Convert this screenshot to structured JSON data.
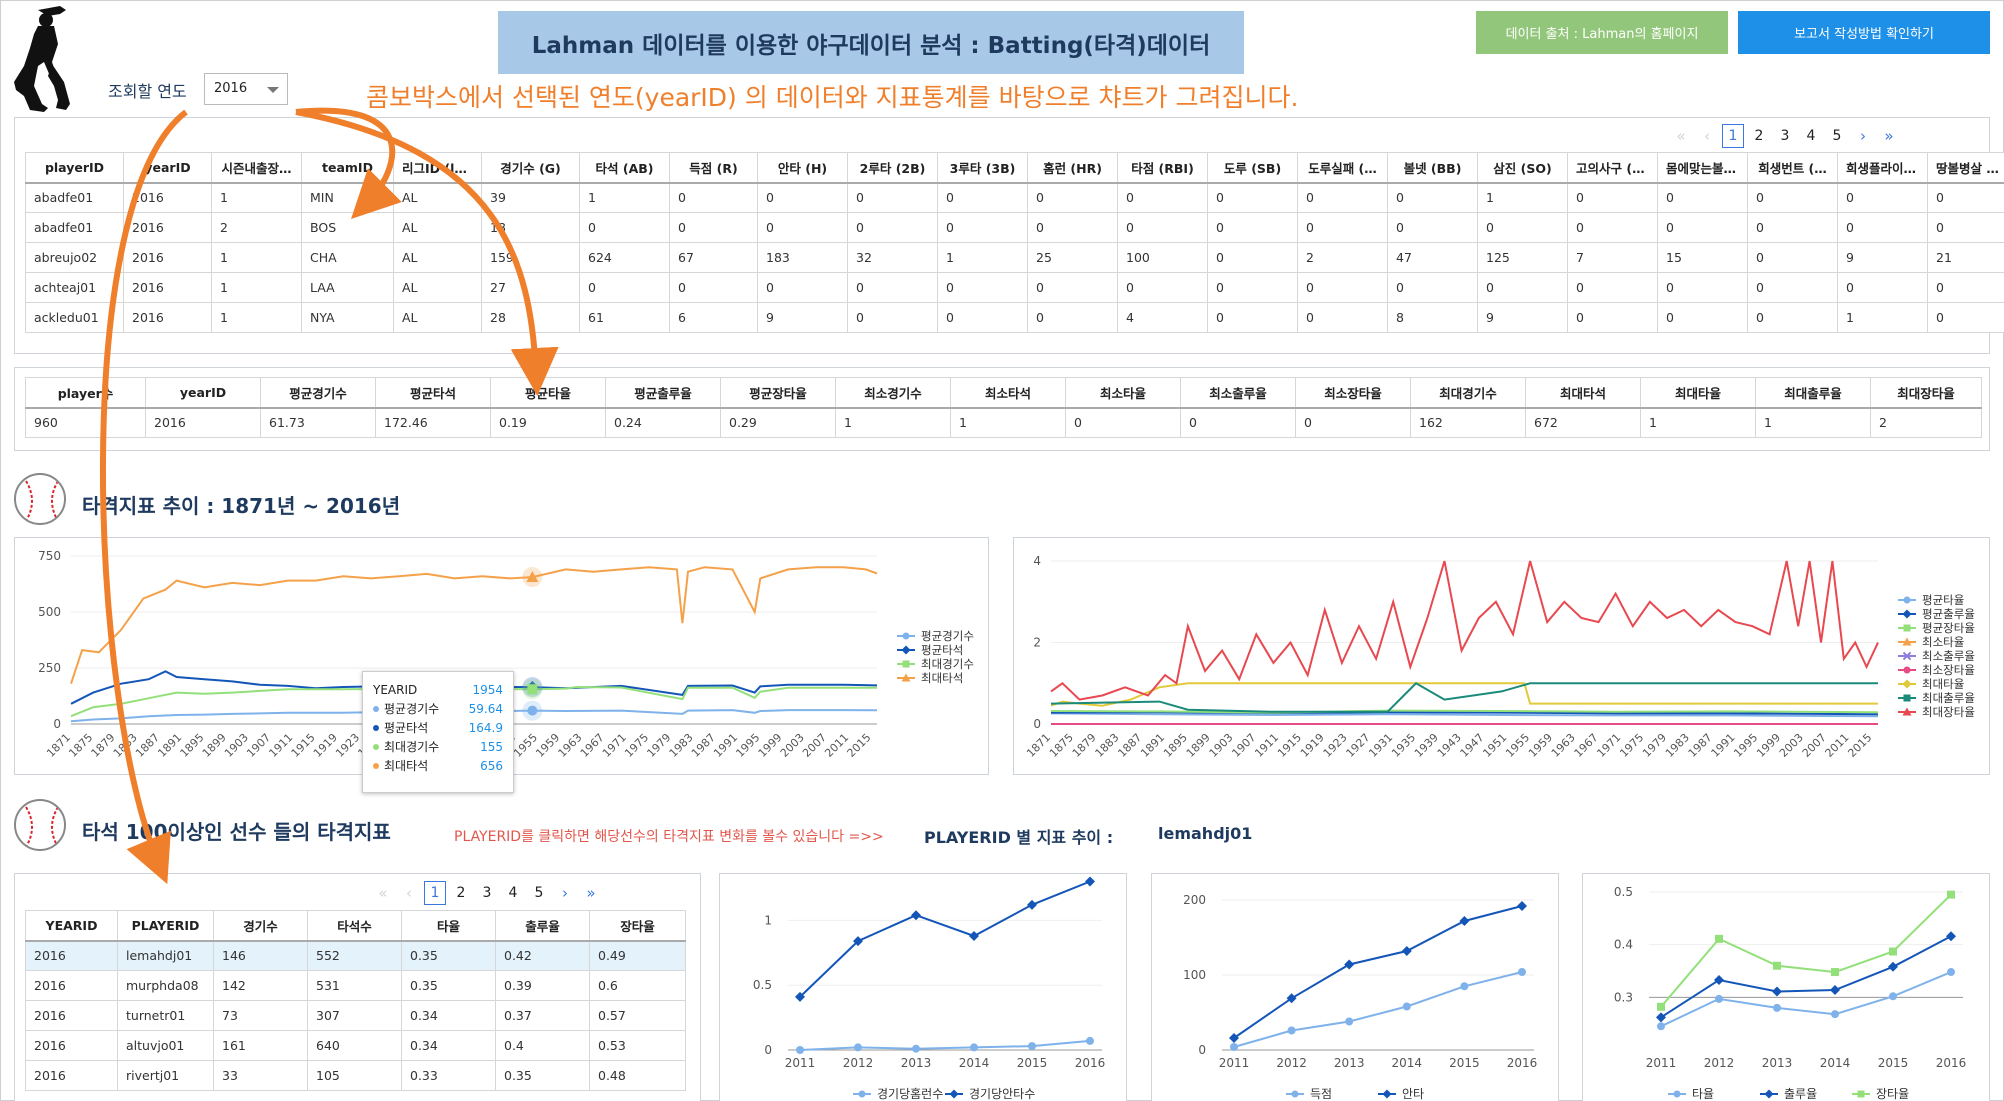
{
  "header": {
    "title": "Lahman 데이터를 이용한 야구데이터 분석 : Batting(타격)데이터",
    "source_button": "데이터 출처 : Lahman의 홈페이지",
    "guide_button": "보고서 작성방법 확인하기",
    "year_label": "조회할 연도",
    "year_value": "2016",
    "info_text": "콤보박스에서 선택된 연도(yearID) 의 데이터와 지표통계를 바탕으로 챠트가 그려집니다."
  },
  "colors": {
    "title_bg": "#a7c8e6",
    "green_button": "#92c77b",
    "blue_button": "#1e90e8",
    "annotation": "#f07f2c",
    "accent_red": "#e2574c"
  },
  "icons": {
    "player_logo": "batter-silhouette-icon",
    "section_icon": "baseball-icon"
  },
  "batting_table": {
    "pager": {
      "first": "«",
      "prev": "‹",
      "pages": [
        "1",
        "2",
        "3",
        "4",
        "5"
      ],
      "current": "1",
      "next": "›",
      "last": "»"
    },
    "columns": [
      "playerID",
      "yearID",
      "시즌내출장…",
      "teamID",
      "리그ID (lgID)",
      "경기수 (G)",
      "타석 (AB)",
      "득점 (R)",
      "안타 (H)",
      "2루타 (2B)",
      "3루타 (3B)",
      "홈런 (HR)",
      "타점 (RBI)",
      "도루 (SB)",
      "도루실패 (…",
      "볼넷 (BB)",
      "삼진 (SO)",
      "고의사구 (I…",
      "몸에맞는볼 …",
      "희생번트 (…",
      "희생플라이 …",
      "땅볼병살 (…"
    ],
    "rows": [
      [
        "abadfe01",
        "2016",
        "1",
        "MIN",
        "AL",
        "39",
        "1",
        "0",
        "0",
        "0",
        "0",
        "0",
        "0",
        "0",
        "0",
        "0",
        "1",
        "0",
        "0",
        "0",
        "0",
        "0"
      ],
      [
        "abadfe01",
        "2016",
        "2",
        "BOS",
        "AL",
        "18",
        "0",
        "0",
        "0",
        "0",
        "0",
        "0",
        "0",
        "0",
        "0",
        "0",
        "0",
        "0",
        "0",
        "0",
        "0",
        "0"
      ],
      [
        "abreujo02",
        "2016",
        "1",
        "CHA",
        "AL",
        "159",
        "624",
        "67",
        "183",
        "32",
        "1",
        "25",
        "100",
        "0",
        "2",
        "47",
        "125",
        "7",
        "15",
        "0",
        "9",
        "21"
      ],
      [
        "achteaj01",
        "2016",
        "1",
        "LAA",
        "AL",
        "27",
        "0",
        "0",
        "0",
        "0",
        "0",
        "0",
        "0",
        "0",
        "0",
        "0",
        "0",
        "0",
        "0",
        "0",
        "0",
        "0"
      ],
      [
        "ackledu01",
        "2016",
        "1",
        "NYA",
        "AL",
        "28",
        "61",
        "6",
        "9",
        "0",
        "0",
        "0",
        "4",
        "0",
        "0",
        "8",
        "9",
        "0",
        "0",
        "0",
        "1",
        "0"
      ]
    ]
  },
  "summary_table": {
    "columns": [
      "player수",
      "yearID",
      "평균경기수",
      "평균타석",
      "평균타율",
      "평균출루율",
      "평균장타율",
      "최소경기수",
      "최소타석",
      "최소타율",
      "최소출루율",
      "최소장타율",
      "최대경기수",
      "최대타석",
      "최대타율",
      "최대출루율",
      "최대장타율"
    ],
    "row": [
      "960",
      "2016",
      "61.73",
      "172.46",
      "0.19",
      "0.24",
      "0.29",
      "1",
      "1",
      "0",
      "0",
      "0",
      "162",
      "672",
      "1",
      "1",
      "2"
    ]
  },
  "section1": {
    "title": "타격지표 추이 : 1871년 ~ 2016년"
  },
  "section2": {
    "title": "타석 100이상인  선수 들의 타격지표",
    "note": "PLAYERID를 클릭하면 해당선수의 타격지표 변화를 볼수 있습니다 =>>",
    "player_label": "PLAYERID 별 지표 추이 :",
    "player_value": "lemahdj01"
  },
  "player_table": {
    "pager": {
      "first": "«",
      "prev": "‹",
      "pages": [
        "1",
        "2",
        "3",
        "4",
        "5"
      ],
      "current": "1",
      "next": "›",
      "last": "»"
    },
    "columns": [
      "YEARID",
      "PLAYERID",
      "경기수",
      "타석수",
      "타율",
      "출루율",
      "장타율"
    ],
    "rows": [
      [
        "2016",
        "lemahdj01",
        "146",
        "552",
        "0.35",
        "0.42",
        "0.49"
      ],
      [
        "2016",
        "murphda08",
        "142",
        "531",
        "0.35",
        "0.39",
        "0.6"
      ],
      [
        "2016",
        "turnetr01",
        "73",
        "307",
        "0.34",
        "0.37",
        "0.57"
      ],
      [
        "2016",
        "altuvjo01",
        "161",
        "640",
        "0.34",
        "0.4",
        "0.53"
      ],
      [
        "2016",
        "rivertj01",
        "33",
        "105",
        "0.33",
        "0.35",
        "0.48"
      ]
    ],
    "selected_index": 0
  },
  "tooltip": {
    "header_key": "YEARID",
    "header_value": "1954",
    "rows": [
      {
        "label": "평균경기수",
        "value": "59.64",
        "color": "#7fb2ea"
      },
      {
        "label": "평균타석",
        "value": "164.9",
        "color": "#1456b8"
      },
      {
        "label": "최대경기수",
        "value": "155",
        "color": "#93e07a"
      },
      {
        "label": "최대타석",
        "value": "656",
        "color": "#f5a14a"
      }
    ]
  },
  "chart_data": [
    {
      "type": "line",
      "x_tick_labels": [
        "1871",
        "1875",
        "1879",
        "1883",
        "1887",
        "1891",
        "1895",
        "1899",
        "1903",
        "1907",
        "1911",
        "1915",
        "1919",
        "1923",
        "1927",
        "1931",
        "1935",
        "1939",
        "1943",
        "1947",
        "1951",
        "1955",
        "1959",
        "1963",
        "1967",
        "1971",
        "1975",
        "1979",
        "1983",
        "1987",
        "1991",
        "1995",
        "1999",
        "2003",
        "2007",
        "2011",
        "2015"
      ],
      "x_range": [
        1871,
        2016
      ],
      "ylim": [
        0,
        750
      ],
      "y_ticks": [
        0,
        250,
        500,
        750
      ],
      "legend_position": "right",
      "series": [
        {
          "name": "평균경기수",
          "color": "#7fb2ea",
          "marker": "circle",
          "x": [
            1871,
            1875,
            1880,
            1885,
            1890,
            1895,
            1900,
            1910,
            1920,
            1930,
            1940,
            1954,
            1960,
            1970,
            1981,
            1982,
            1990,
            1994,
            1995,
            2000,
            2010,
            2016
          ],
          "y": [
            12,
            20,
            25,
            35,
            40,
            42,
            45,
            50,
            50,
            55,
            55,
            59.64,
            58,
            60,
            45,
            60,
            62,
            50,
            58,
            62,
            62,
            61.73
          ]
        },
        {
          "name": "평균타석",
          "color": "#1456b8",
          "marker": "diamond",
          "x": [
            1871,
            1875,
            1880,
            1885,
            1888,
            1890,
            1895,
            1900,
            1905,
            1910,
            1915,
            1920,
            1930,
            1940,
            1950,
            1954,
            1960,
            1970,
            1981,
            1982,
            1990,
            1994,
            1995,
            2000,
            2010,
            2016
          ],
          "y": [
            90,
            140,
            180,
            200,
            235,
            210,
            200,
            190,
            175,
            170,
            160,
            165,
            170,
            165,
            165,
            164.9,
            160,
            170,
            130,
            170,
            172,
            140,
            168,
            175,
            175,
            172.46
          ]
        },
        {
          "name": "최대경기수",
          "color": "#93e07a",
          "marker": "square",
          "x": [
            1871,
            1875,
            1880,
            1885,
            1890,
            1895,
            1900,
            1910,
            1920,
            1930,
            1940,
            1954,
            1960,
            1962,
            1970,
            1981,
            1982,
            1990,
            1994,
            1995,
            2000,
            2010,
            2016
          ],
          "y": [
            35,
            75,
            90,
            115,
            140,
            135,
            140,
            155,
            155,
            157,
            158,
            155,
            158,
            165,
            163,
            111,
            162,
            162,
            117,
            144,
            162,
            162,
            162
          ]
        },
        {
          "name": "최대타석",
          "color": "#f5a14a",
          "marker": "triangle",
          "x": [
            1871,
            1873,
            1876,
            1880,
            1884,
            1888,
            1890,
            1895,
            1900,
            1905,
            1910,
            1915,
            1920,
            1925,
            1930,
            1935,
            1940,
            1945,
            1950,
            1954,
            1960,
            1965,
            1970,
            1975,
            1980,
            1981,
            1982,
            1985,
            1990,
            1994,
            1995,
            2000,
            2005,
            2010,
            2014,
            2016
          ],
          "y": [
            180,
            330,
            320,
            420,
            560,
            600,
            640,
            610,
            630,
            620,
            640,
            640,
            660,
            650,
            660,
            670,
            650,
            660,
            650,
            656,
            690,
            680,
            690,
            700,
            690,
            450,
            680,
            700,
            690,
            500,
            650,
            690,
            700,
            700,
            690,
            672
          ]
        }
      ]
    },
    {
      "type": "line",
      "x_tick_labels": [
        "1871",
        "1875",
        "1879",
        "1883",
        "1887",
        "1891",
        "1895",
        "1899",
        "1903",
        "1907",
        "1911",
        "1915",
        "1919",
        "1923",
        "1927",
        "1931",
        "1935",
        "1939",
        "1943",
        "1947",
        "1951",
        "1955",
        "1959",
        "1963",
        "1967",
        "1971",
        "1975",
        "1979",
        "1983",
        "1987",
        "1991",
        "1995",
        "1999",
        "2003",
        "2007",
        "2011",
        "2015"
      ],
      "x_range": [
        1871,
        2016
      ],
      "ylim": [
        0,
        4
      ],
      "y_ticks": [
        0,
        2,
        4
      ],
      "legend_position": "right",
      "series": [
        {
          "name": "평균타율",
          "color": "#7fb2ea",
          "marker": "circle",
          "x": [
            1871,
            1890,
            1910,
            1930,
            1950,
            1970,
            1990,
            2016
          ],
          "y": [
            0.26,
            0.24,
            0.22,
            0.24,
            0.22,
            0.21,
            0.21,
            0.19
          ]
        },
        {
          "name": "평균출루율",
          "color": "#1456b8",
          "marker": "diamond",
          "x": [
            1871,
            1890,
            1910,
            1930,
            1950,
            1970,
            1990,
            2016
          ],
          "y": [
            0.28,
            0.29,
            0.27,
            0.29,
            0.28,
            0.26,
            0.26,
            0.24
          ]
        },
        {
          "name": "평균장타율",
          "color": "#93e07a",
          "marker": "square",
          "x": [
            1871,
            1890,
            1910,
            1930,
            1950,
            1970,
            1990,
            2016
          ],
          "y": [
            0.32,
            0.31,
            0.28,
            0.33,
            0.32,
            0.3,
            0.31,
            0.29
          ]
        },
        {
          "name": "최소타율",
          "color": "#f5a14a",
          "marker": "triangle",
          "x": [
            1871,
            2016
          ],
          "y": [
            0,
            0
          ]
        },
        {
          "name": "최소출루율",
          "color": "#8b7ee0",
          "marker": "cross",
          "x": [
            1871,
            2016
          ],
          "y": [
            0,
            0
          ]
        },
        {
          "name": "최소장타율",
          "color": "#e74b85",
          "marker": "circle",
          "x": [
            1871,
            2016
          ],
          "y": [
            0,
            0
          ]
        },
        {
          "name": "최대타율",
          "color": "#e2c93a",
          "marker": "diamond",
          "x": [
            1871,
            1873,
            1876,
            1880,
            1885,
            1890,
            1895,
            1900,
            1905,
            1910,
            1915,
            1920,
            1925,
            1930,
            1935,
            1940,
            1945,
            1950,
            1954,
            1955,
            2016
          ],
          "y": [
            0.45,
            0.55,
            0.5,
            0.45,
            0.6,
            0.9,
            1,
            1,
            1,
            1,
            1,
            1,
            1,
            1,
            1,
            1,
            1,
            1,
            1,
            0.5,
            0.5
          ]
        },
        {
          "name": "최대출루율",
          "color": "#1a8a7a",
          "marker": "square",
          "x": [
            1871,
            1890,
            1895,
            1910,
            1920,
            1930,
            1935,
            1940,
            1950,
            1955,
            2016
          ],
          "y": [
            0.5,
            0.55,
            0.35,
            0.3,
            0.3,
            0.3,
            1,
            0.6,
            0.8,
            1,
            1
          ]
        },
        {
          "name": "최대장타율",
          "color": "#e8484f",
          "marker": "triangle",
          "x": [
            1871,
            1873,
            1876,
            1880,
            1884,
            1888,
            1891,
            1893,
            1895,
            1898,
            1901,
            1904,
            1907,
            1910,
            1913,
            1916,
            1919,
            1922,
            1925,
            1928,
            1931,
            1934,
            1937,
            1940,
            1943,
            1946,
            1949,
            1952,
            1955,
            1958,
            1961,
            1964,
            1967,
            1970,
            1973,
            1976,
            1979,
            1982,
            1985,
            1988,
            1991,
            1994,
            1997,
            2000,
            2002,
            2004,
            2006,
            2008,
            2010,
            2012,
            2014,
            2016
          ],
          "y": [
            0.8,
            1,
            0.6,
            0.7,
            0.9,
            0.7,
            1.2,
            1,
            2.4,
            1.3,
            1.8,
            1.1,
            2.2,
            1.5,
            2,
            1.2,
            2.8,
            1.5,
            2.4,
            1.6,
            3,
            1.4,
            2.6,
            4,
            1.8,
            2.6,
            3,
            2.2,
            4,
            2.5,
            3,
            2.6,
            2.5,
            3.2,
            2.4,
            3,
            2.6,
            2.8,
            2.4,
            2.8,
            2.5,
            2.4,
            2.2,
            4,
            2.4,
            4,
            2,
            4,
            1.6,
            2,
            1.4,
            2
          ]
        }
      ]
    },
    {
      "type": "line",
      "categories": [
        "2011",
        "2012",
        "2013",
        "2014",
        "2015",
        "2016"
      ],
      "ylim": [
        0,
        1.25
      ],
      "y_ticks": [
        0,
        0.5,
        1
      ],
      "legend_position": "bottom",
      "series": [
        {
          "name": "경기당홈런수",
          "color": "#7fb2ea",
          "marker": "circle",
          "values": [
            0,
            0.02,
            0.01,
            0.02,
            0.03,
            0.07
          ]
        },
        {
          "name": "경기당안타수",
          "color": "#1456b8",
          "marker": "diamond",
          "values": [
            0.41,
            0.84,
            1.04,
            0.88,
            1.12,
            1.3
          ]
        }
      ]
    },
    {
      "type": "line",
      "categories": [
        "2011",
        "2012",
        "2013",
        "2014",
        "2015",
        "2016"
      ],
      "ylim": [
        0,
        200
      ],
      "y_ticks": [
        0,
        100,
        200
      ],
      "legend_position": "bottom",
      "series": [
        {
          "name": "득점",
          "color": "#7fb2ea",
          "marker": "circle",
          "values": [
            4,
            26,
            38,
            58,
            85,
            104
          ]
        },
        {
          "name": "안타",
          "color": "#1456b8",
          "marker": "diamond",
          "values": [
            16,
            69,
            114,
            132,
            172,
            192
          ]
        }
      ]
    },
    {
      "type": "line",
      "categories": [
        "2011",
        "2012",
        "2013",
        "2014",
        "2015",
        "2016"
      ],
      "ylim": [
        0.2,
        0.5
      ],
      "y_ticks": [
        0.3,
        0.4,
        0.5
      ],
      "legend_position": "bottom",
      "series": [
        {
          "name": "타율",
          "color": "#7fb2ea",
          "marker": "circle",
          "values": [
            0.245,
            0.297,
            0.28,
            0.268,
            0.302,
            0.348
          ]
        },
        {
          "name": "출루율",
          "color": "#1456b8",
          "marker": "diamond",
          "values": [
            0.262,
            0.333,
            0.311,
            0.314,
            0.358,
            0.416
          ]
        },
        {
          "name": "장타율",
          "color": "#93e07a",
          "marker": "square",
          "values": [
            0.282,
            0.411,
            0.36,
            0.348,
            0.387,
            0.495
          ]
        }
      ]
    }
  ]
}
